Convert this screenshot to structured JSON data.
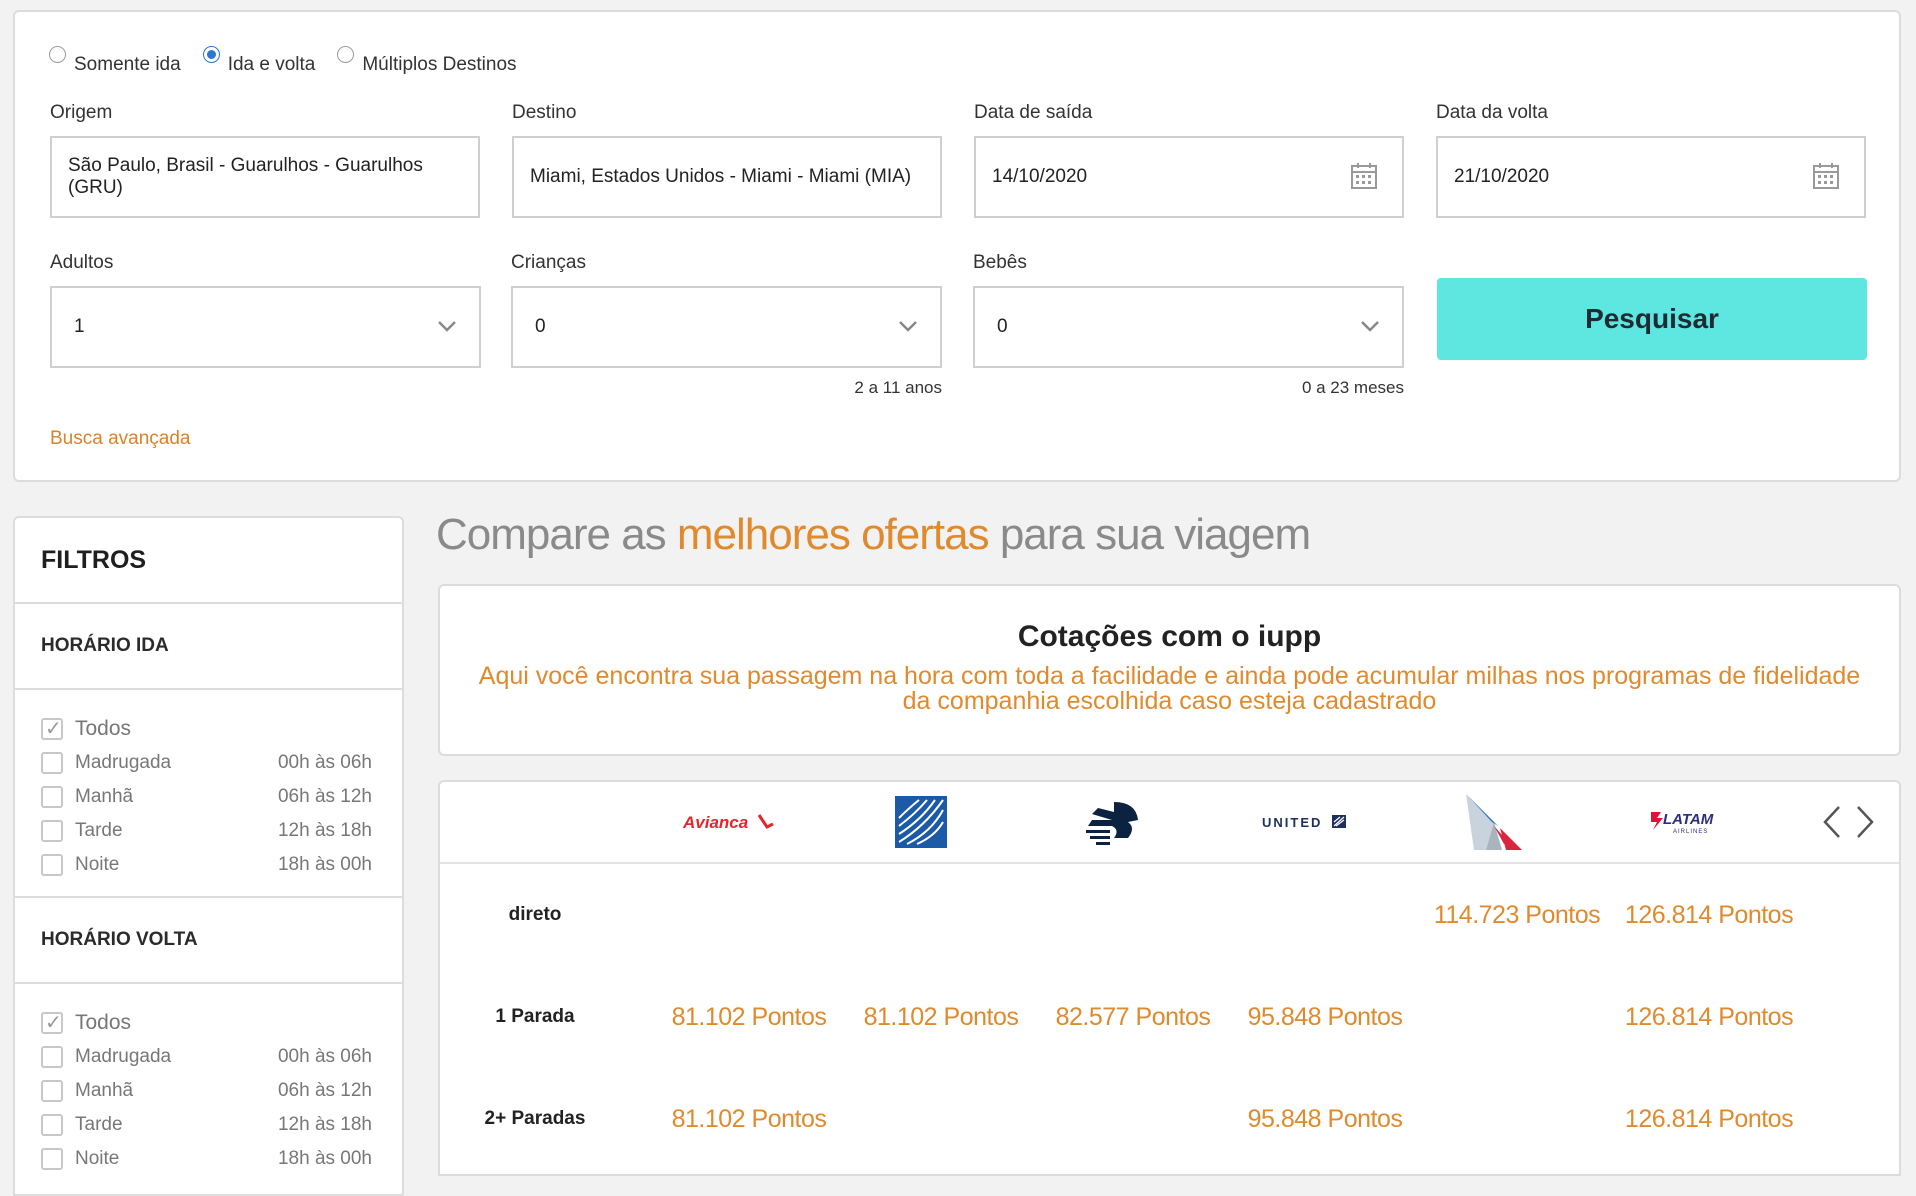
{
  "trip_types": [
    {
      "label": "Somente ida",
      "selected": false
    },
    {
      "label": "Ida e volta",
      "selected": true
    },
    {
      "label": "Múltiplos Destinos",
      "selected": false
    }
  ],
  "fields": {
    "origem": {
      "label": "Origem",
      "value": "São Paulo, Brasil - Guarulhos - Guarulhos (GRU)"
    },
    "destino": {
      "label": "Destino",
      "value": "Miami, Estados Unidos - Miami - Miami (MIA)"
    },
    "data_saida": {
      "label": "Data de saída",
      "value": "14/10/2020"
    },
    "data_volta": {
      "label": "Data da volta",
      "value": "21/10/2020"
    },
    "adultos": {
      "label": "Adultos",
      "value": "1"
    },
    "criancas": {
      "label": "Crianças",
      "value": "0",
      "hint": "2 a 11 anos"
    },
    "bebes": {
      "label": "Bebês",
      "value": "0",
      "hint": "0 a 23 meses"
    }
  },
  "search_button": "Pesquisar",
  "advanced_link": "Busca avançada",
  "filters": {
    "title": "FILTROS",
    "horario_ida": {
      "title": "HORÁRIO IDA",
      "items": [
        {
          "name": "Todos",
          "range": "",
          "checked": true
        },
        {
          "name": "Madrugada",
          "range": "00h às 06h",
          "checked": false
        },
        {
          "name": "Manhã",
          "range": "06h às 12h",
          "checked": false
        },
        {
          "name": "Tarde",
          "range": "12h às 18h",
          "checked": false
        },
        {
          "name": "Noite",
          "range": "18h às 00h",
          "checked": false
        }
      ]
    },
    "horario_volta": {
      "title": "HORÁRIO VOLTA",
      "items": [
        {
          "name": "Todos",
          "range": "",
          "checked": true
        },
        {
          "name": "Madrugada",
          "range": "00h às 06h",
          "checked": false
        },
        {
          "name": "Manhã",
          "range": "06h às 12h",
          "checked": false
        },
        {
          "name": "Tarde",
          "range": "12h às 18h",
          "checked": false
        },
        {
          "name": "Noite",
          "range": "18h às 00h",
          "checked": false
        }
      ]
    }
  },
  "headline": {
    "part1": "Compare as ",
    "highlight": "melhores ofertas",
    "part2": " para sua viagem"
  },
  "info": {
    "title": "Cotações com o iupp",
    "text": "Aqui você encontra sua passagem na hora com toda a facilidade e ainda pode acumular milhas nos programas de fidelidade da companhia escolhida caso esteja cadastrado"
  },
  "airlines": [
    "Avianca",
    "Copa",
    "Aeroméxico",
    "UNITED",
    "American Airlines",
    "LATAM AIRLINES"
  ],
  "results": {
    "rows": [
      {
        "label": "direto",
        "prices": [
          "",
          "",
          "",
          "",
          "114.723 Pontos",
          "126.814 Pontos"
        ]
      },
      {
        "label": "1 Parada",
        "prices": [
          "81.102 Pontos",
          "81.102 Pontos",
          "82.577 Pontos",
          "95.848 Pontos",
          "",
          "126.814 Pontos"
        ]
      },
      {
        "label": "2+ Paradas",
        "prices": [
          "81.102 Pontos",
          "",
          "",
          "95.848 Pontos",
          "",
          "126.814 Pontos"
        ]
      }
    ]
  },
  "colors": {
    "accent_orange": "#e08a2e",
    "search_button": "#5ee6e0",
    "radio_blue": "#2a78d6"
  }
}
